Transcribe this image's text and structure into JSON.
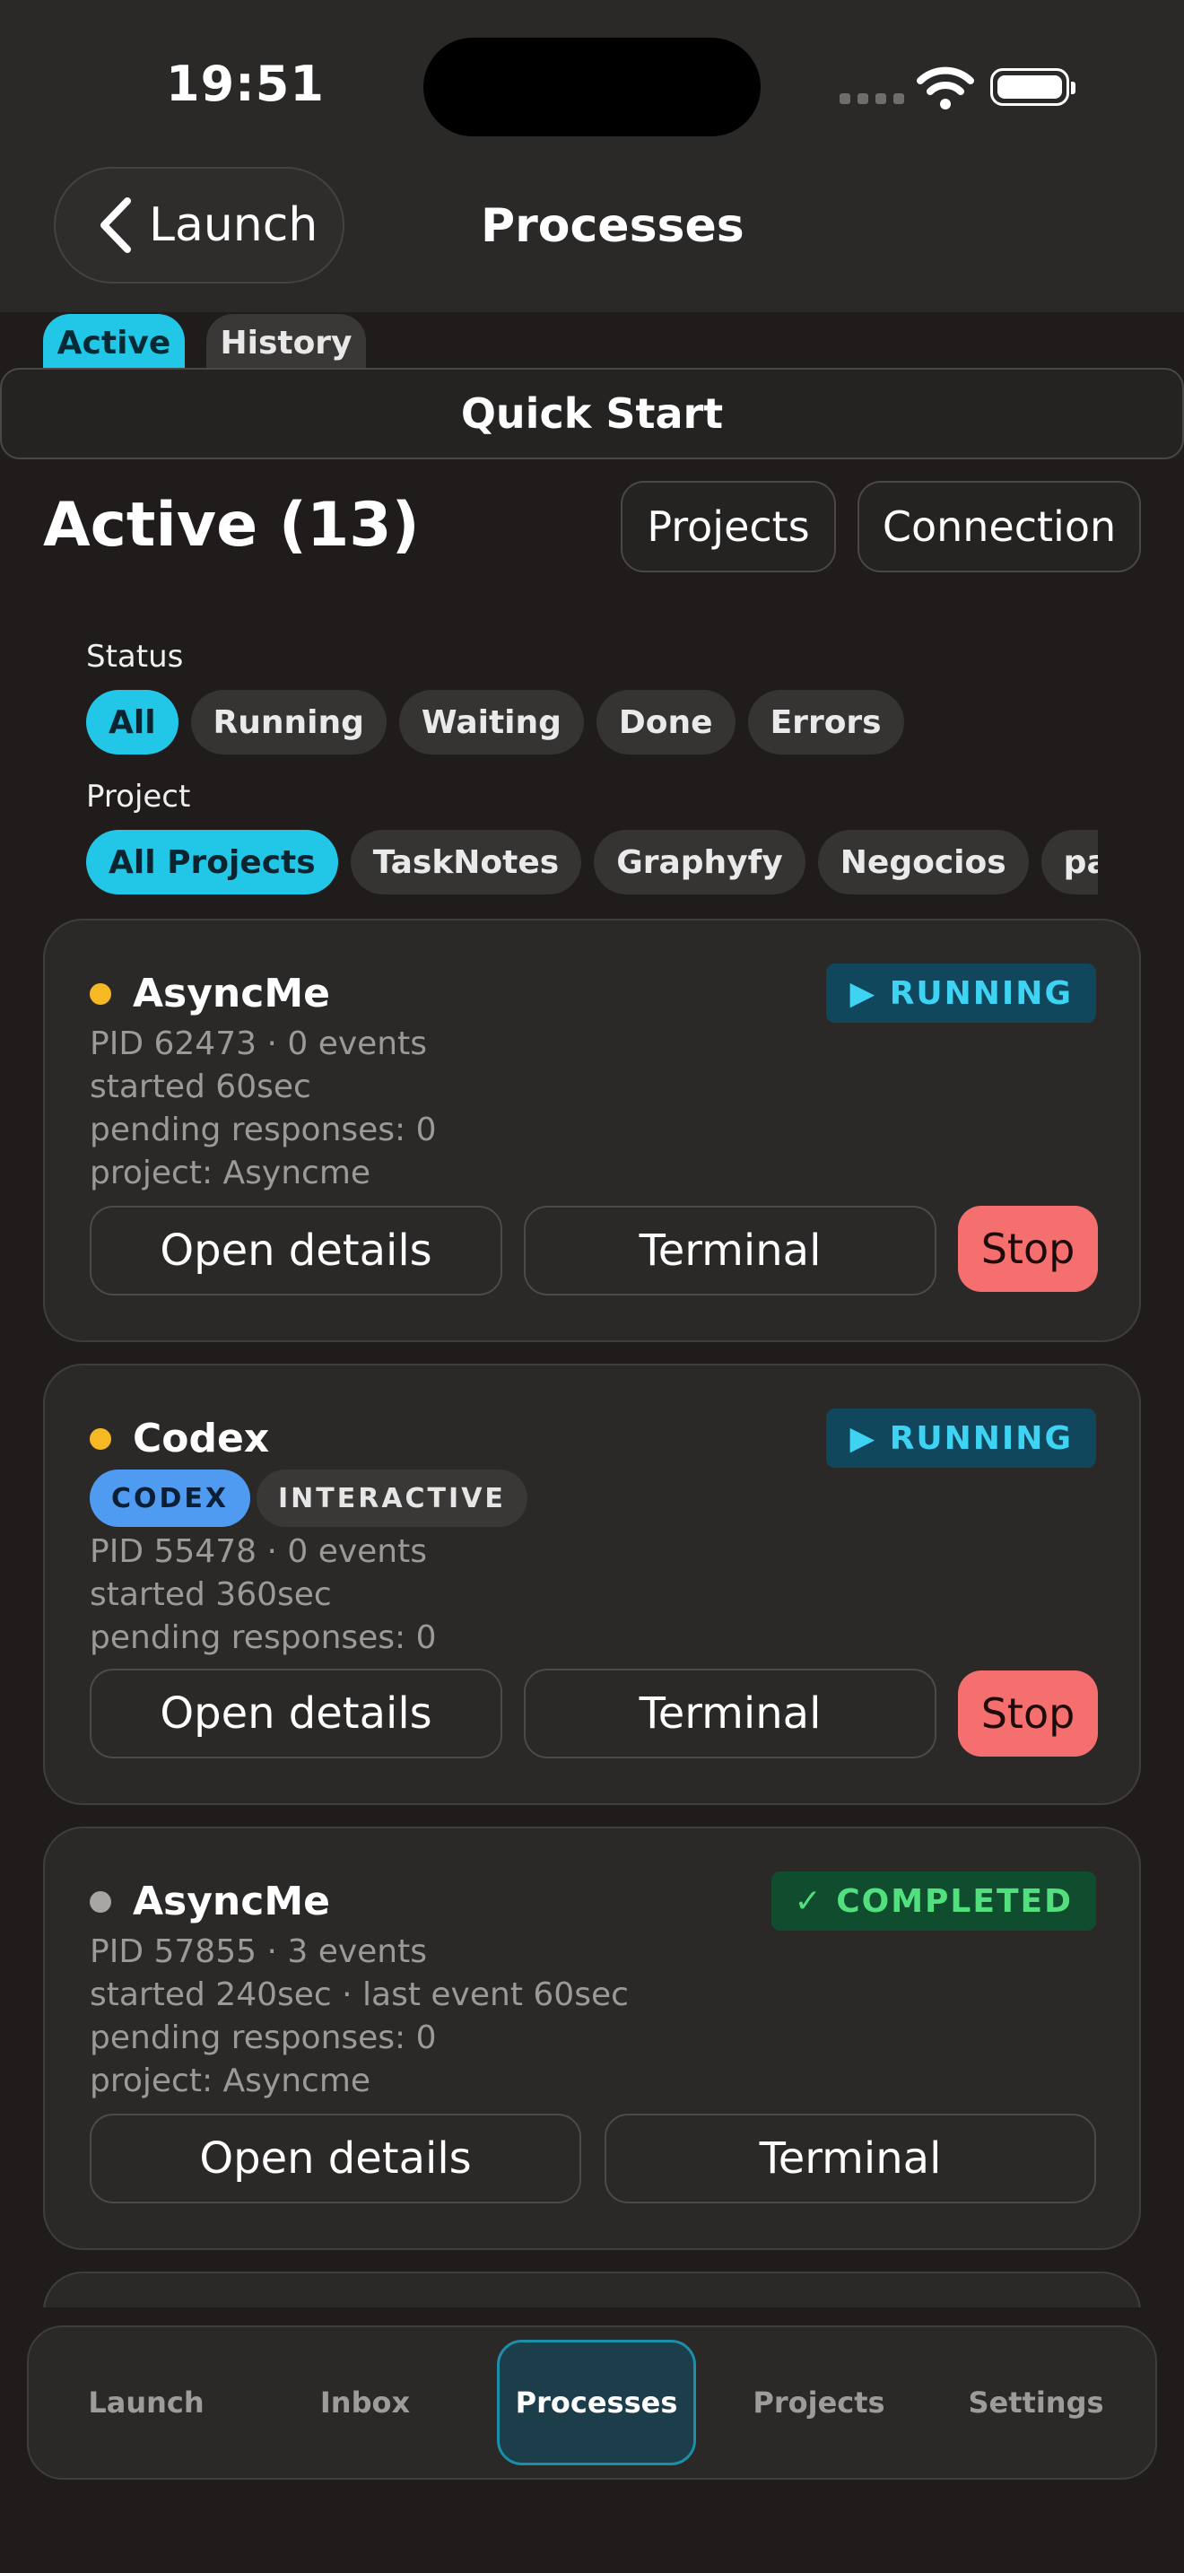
{
  "status_bar": {
    "time": "19:51"
  },
  "nav": {
    "back_label": "Launch",
    "title": "Processes"
  },
  "segments": {
    "active": "Active",
    "history": "History"
  },
  "quick_start": "Quick Start",
  "section": {
    "title": "Active (13)",
    "projects_button": "Projects",
    "connection_button": "Connection"
  },
  "filters": {
    "status_label": "Status",
    "status_chips": [
      "All",
      "Running",
      "Waiting",
      "Done",
      "Errors"
    ],
    "status_selected": "All",
    "project_label": "Project",
    "project_chips": [
      "All Projects",
      "TaskNotes",
      "Graphyfy",
      "Negocios",
      "paperclip"
    ],
    "project_selected": "All Projects"
  },
  "processes": [
    {
      "name": "AsyncMe",
      "status": "▶ RUNNING",
      "dot_color": "#f6b924",
      "meta": [
        "PID 62473 · 0 events",
        "started 60sec",
        "pending responses: 0",
        "project: Asyncme"
      ],
      "open_details": "Open details",
      "terminal": "Terminal",
      "stop": "Stop"
    },
    {
      "name": "Codex",
      "status": "▶ RUNNING",
      "dot_color": "#f6b924",
      "tags": [
        "CODEX",
        "INTERACTIVE"
      ],
      "meta": [
        "PID 55478 · 0 events",
        "started 360sec",
        "pending responses: 0"
      ],
      "open_details": "Open details",
      "terminal": "Terminal",
      "stop": "Stop"
    },
    {
      "name": "AsyncMe",
      "status": "✓ COMPLETED",
      "dot_color": "#a8a5a3",
      "meta": [
        "PID 57855 · 3 events",
        "started 240sec · last event 60sec",
        "pending responses: 0",
        "project: Asyncme"
      ],
      "open_details": "Open details",
      "terminal": "Terminal"
    }
  ],
  "tab_bar": {
    "items": [
      "Launch",
      "Inbox",
      "Processes",
      "Projects",
      "Settings"
    ],
    "active": "Processes"
  },
  "colors": {
    "accent": "#22c7e8",
    "running": "#3fd3f3",
    "completed": "#52e07f",
    "stop": "#f56f6f"
  }
}
